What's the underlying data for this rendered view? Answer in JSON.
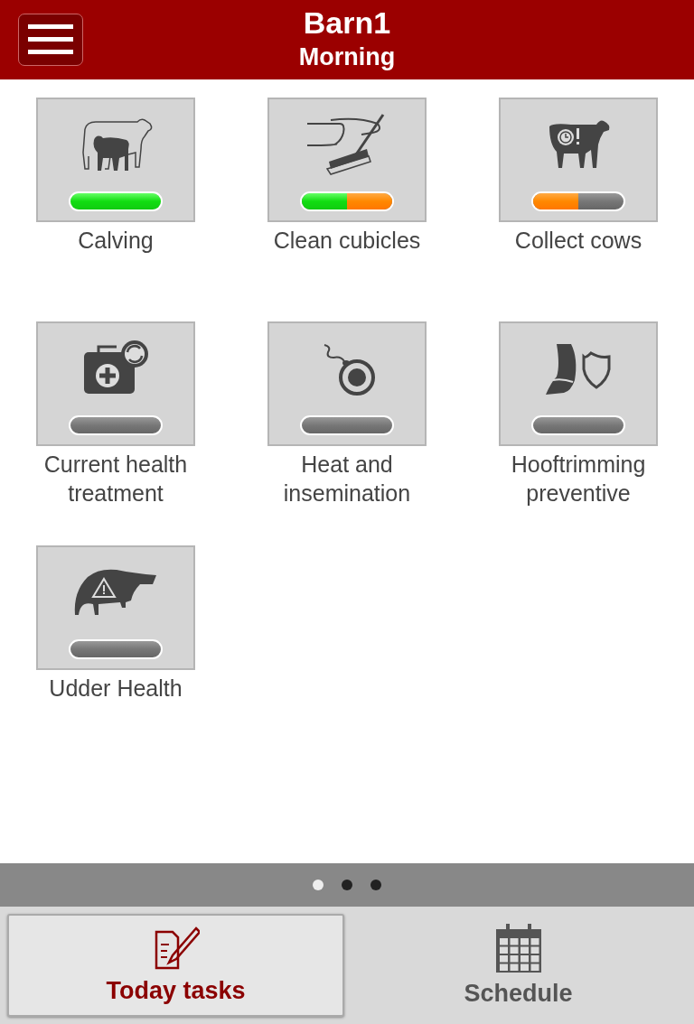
{
  "header": {
    "title": "Barn1",
    "subtitle": "Morning"
  },
  "tasks": [
    {
      "label": "Calving",
      "kind": "calving",
      "done": {
        "level": 1
      }
    },
    {
      "label": "Clean cubicles",
      "kind": "cleaning",
      "done": {
        "level": 0.5
      },
      "started": {
        "level": 0.5
      }
    },
    {
      "label": "Collect cows",
      "kind": "collect",
      "started": {
        "level": 0.5
      }
    },
    {
      "label": "Current health treatment",
      "kind": "health"
    },
    {
      "label": "Heat and insemination",
      "kind": "insemination"
    },
    {
      "label": "Hooftrimming preventive",
      "kind": "hoof"
    },
    {
      "label": "Udder Health",
      "kind": "udder"
    }
  ],
  "pager": [
    {
      "selected": true
    },
    {
      "selected": false
    },
    {
      "selected": false
    }
  ],
  "tabs": [
    {
      "label": "Today tasks",
      "kind": "tasks",
      "selected": true
    },
    {
      "label": "Schedule",
      "kind": "calendar",
      "selected": false
    }
  ]
}
